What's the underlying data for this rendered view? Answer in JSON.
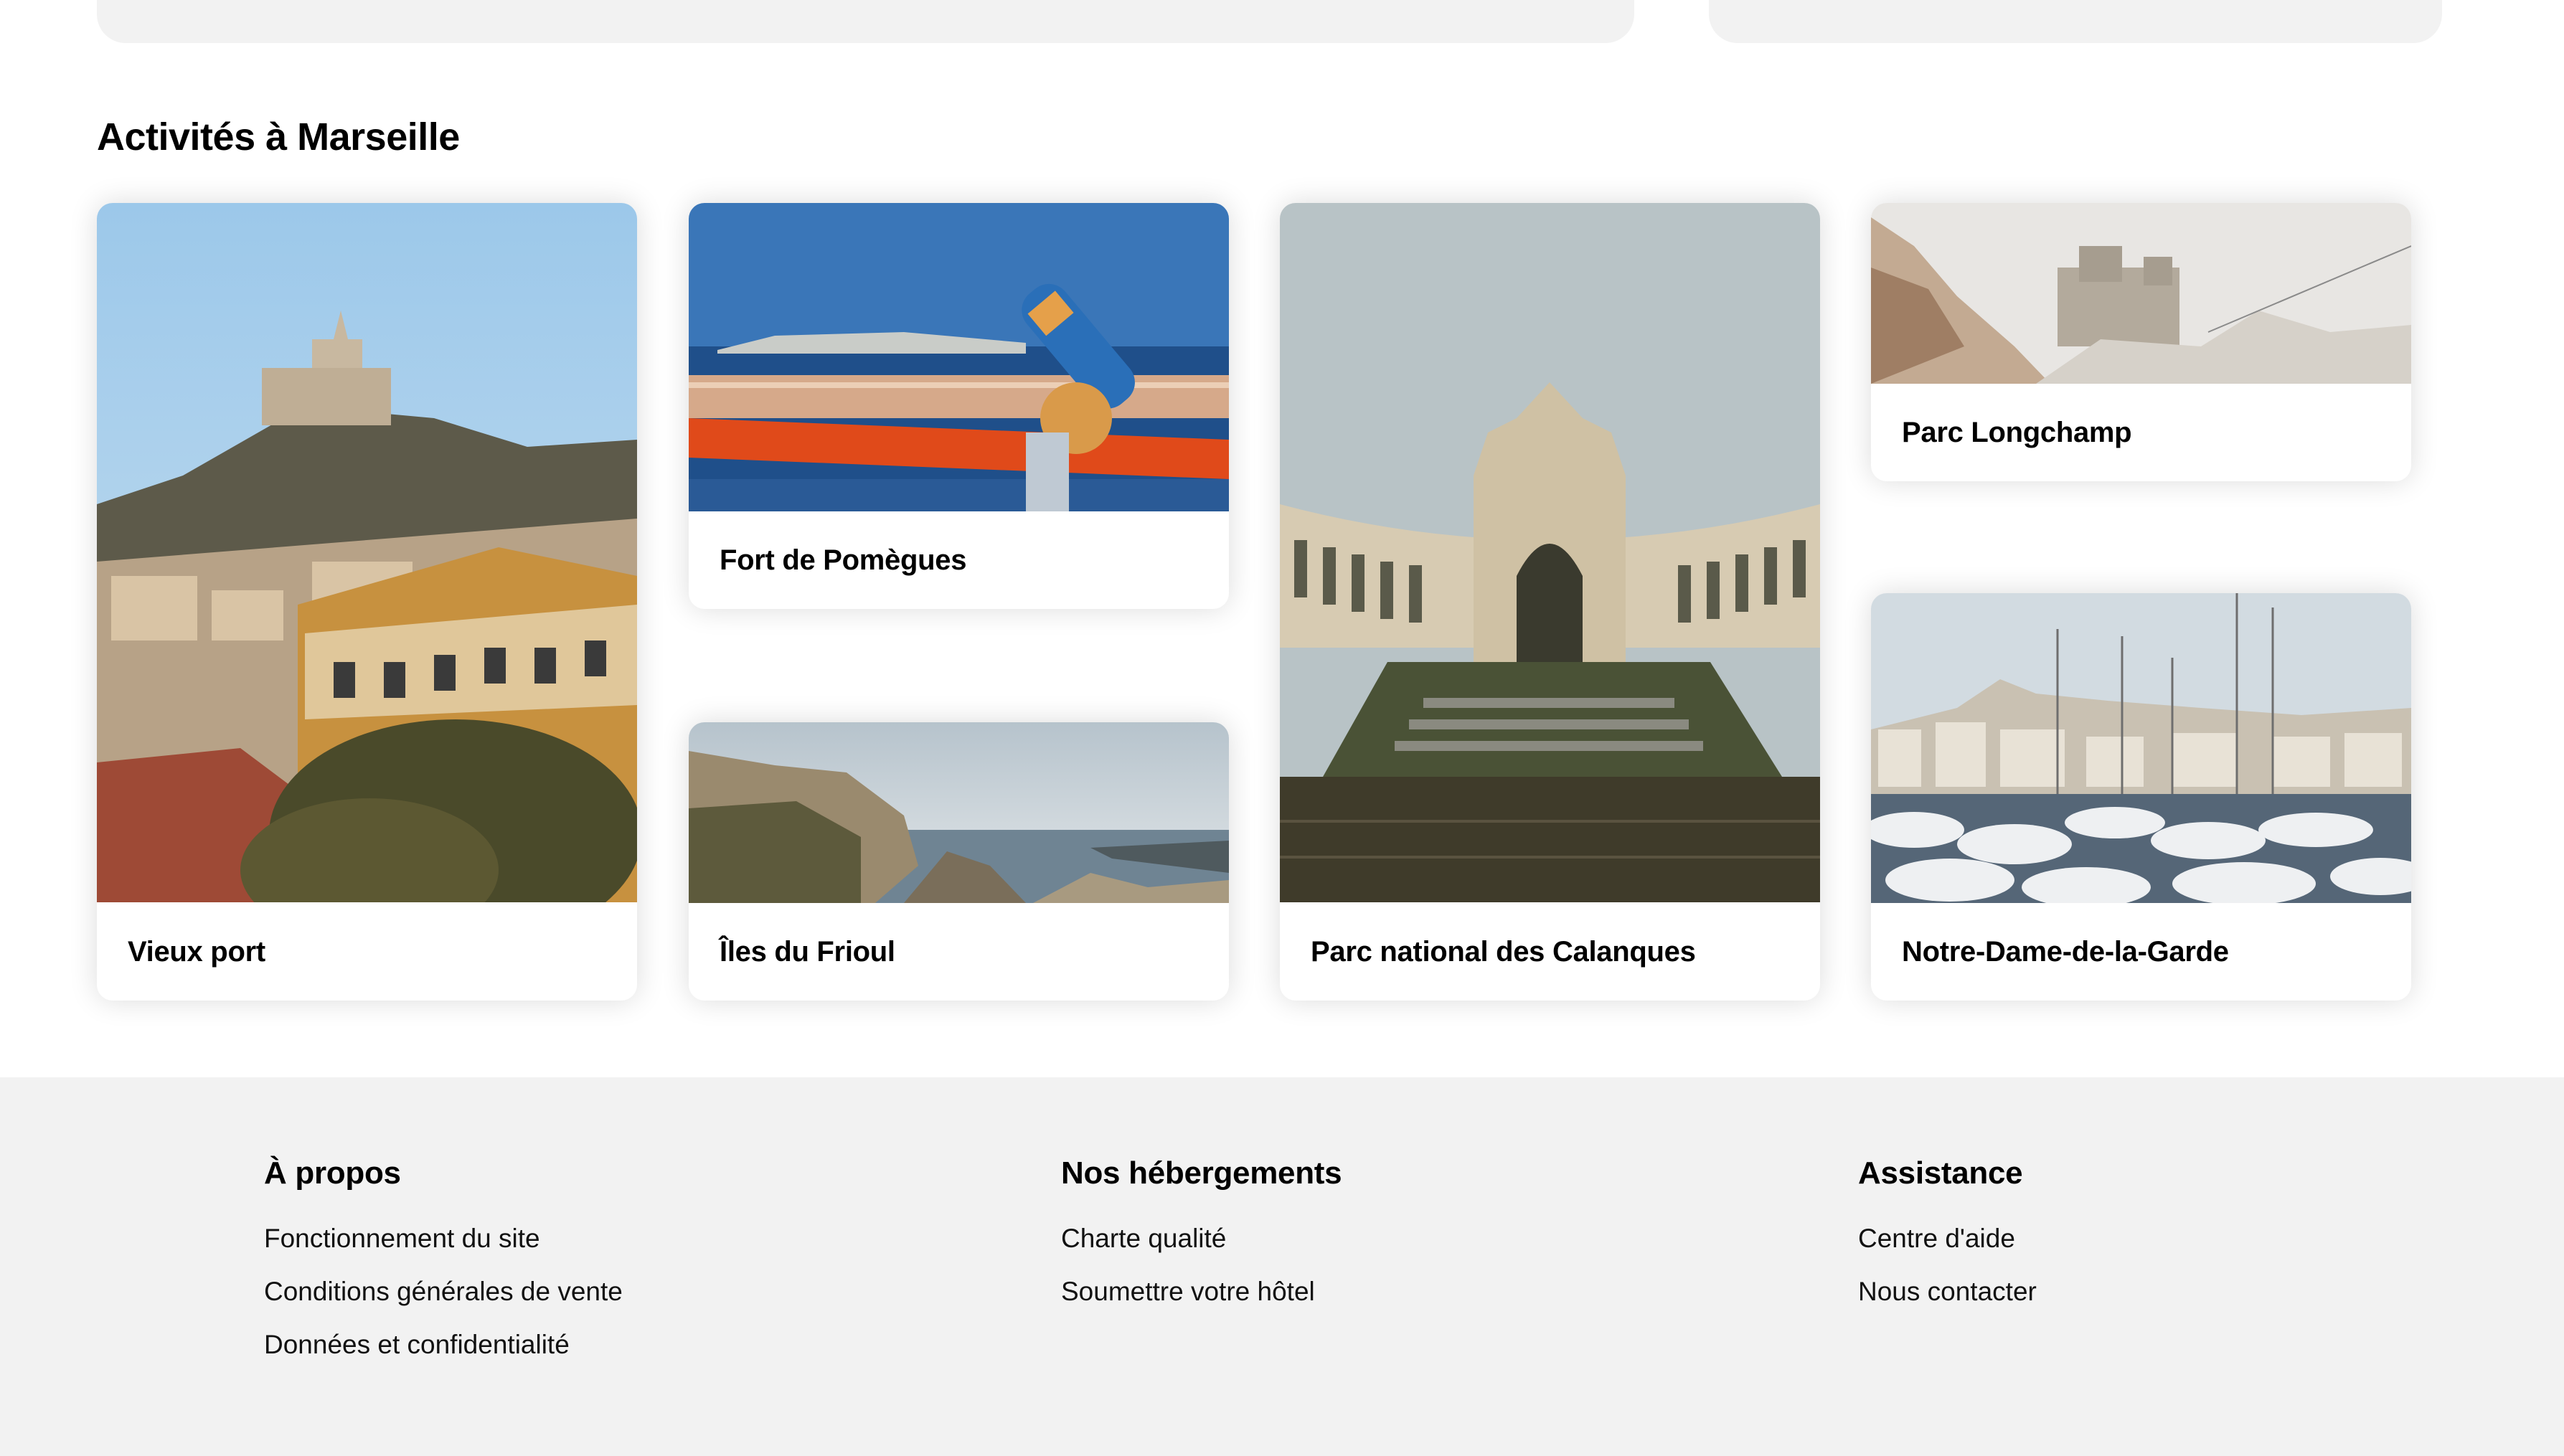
{
  "section_title": "Activités à Marseille",
  "cards": [
    {
      "label": "Vieux port",
      "image": "notre-dame-hill-photo"
    },
    {
      "label": "Fort de Pomègues",
      "image": "telescope-sea-photo"
    },
    {
      "label": "Îles du Frioul",
      "image": "cliffs-sea-photo"
    },
    {
      "label": "Parc national des Calanques",
      "image": "palais-longchamp-photo"
    },
    {
      "label": "Parc Longchamp",
      "image": "fort-ruin-photo"
    },
    {
      "label": "Notre-Dame-de-la-Garde",
      "image": "harbor-boats-photo"
    }
  ],
  "footer": {
    "about": {
      "title": "À propos",
      "links": [
        "Fonctionnement du site",
        "Conditions générales de vente",
        "Données et confidentialité"
      ]
    },
    "lodging": {
      "title": "Nos hébergements",
      "links": [
        "Charte qualité",
        "Soumettre votre hôtel"
      ]
    },
    "support": {
      "title": "Assistance",
      "links": [
        "Centre d'aide",
        "Nous contacter"
      ]
    }
  },
  "colors": {
    "panel_gray": "#f2f2f2",
    "text": "#000000",
    "card_bg": "#ffffff"
  }
}
